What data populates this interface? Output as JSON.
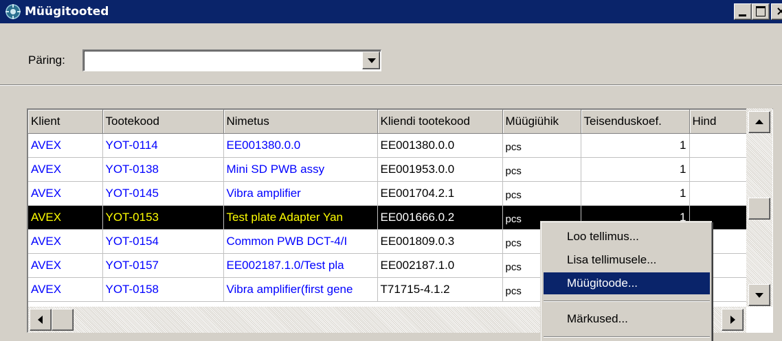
{
  "window": {
    "title": "Müügitooted",
    "icon": "app-icon",
    "controls": [
      "minimize-icon",
      "maximize-icon",
      "close-icon"
    ]
  },
  "query": {
    "label": "Päring:",
    "value": ""
  },
  "grid": {
    "columns": [
      "Klient",
      "Tootekood",
      "Nimetus",
      "Kliendi tootekood",
      "Müügiühik",
      "Teisenduskoef.",
      "Hind"
    ],
    "rows": [
      {
        "klient": "AVEX",
        "tootekood": "YOT-0114",
        "nimetus": "EE001380.0.0",
        "kliendi_tootekood": "EE001380.0.0",
        "muugiuhik": "pcs",
        "teisenduskoef": "1",
        "hind": ""
      },
      {
        "klient": "AVEX",
        "tootekood": "YOT-0138",
        "nimetus": "Mini SD PWB assy",
        "kliendi_tootekood": "EE001953.0.0",
        "muugiuhik": "pcs",
        "teisenduskoef": "1",
        "hind": ""
      },
      {
        "klient": "AVEX",
        "tootekood": "YOT-0145",
        "nimetus": "Vibra amplifier",
        "kliendi_tootekood": "EE001704.2.1",
        "muugiuhik": "pcs",
        "teisenduskoef": "1",
        "hind": ""
      },
      {
        "klient": "AVEX",
        "tootekood": "YOT-0153",
        "nimetus": "Test plate Adapter Yan",
        "kliendi_tootekood": "EE001666.0.2",
        "muugiuhik": "pcs",
        "teisenduskoef": "1",
        "hind": "",
        "selected": true
      },
      {
        "klient": "AVEX",
        "tootekood": "YOT-0154",
        "nimetus": "Common PWB DCT-4/I",
        "kliendi_tootekood": "EE001809.0.3",
        "muugiuhik": "pcs",
        "teisenduskoef": "",
        "hind": ""
      },
      {
        "klient": "AVEX",
        "tootekood": "YOT-0157",
        "nimetus": "EE002187.1.0/Test pla",
        "kliendi_tootekood": "EE002187.1.0",
        "muugiuhik": "pcs",
        "teisenduskoef": "",
        "hind": ""
      },
      {
        "klient": "AVEX",
        "tootekood": "YOT-0158",
        "nimetus": "Vibra amplifier(first gene",
        "kliendi_tootekood": "T71715-4.1.2",
        "muugiuhik": "pcs",
        "teisenduskoef": "",
        "hind": ""
      }
    ]
  },
  "context_menu": {
    "items": [
      {
        "label": "Loo tellimus..."
      },
      {
        "label": "Lisa tellimusele..."
      },
      {
        "label": "Müügitoode...",
        "highlighted": true
      },
      {
        "label": "Märkused..."
      }
    ]
  },
  "colors": {
    "titlebar": "#0a246a",
    "link_text": "#0000ff",
    "selected_row_bg": "#000000",
    "selected_row_text": "#ffff00",
    "menu_highlight": "#0a246a"
  }
}
